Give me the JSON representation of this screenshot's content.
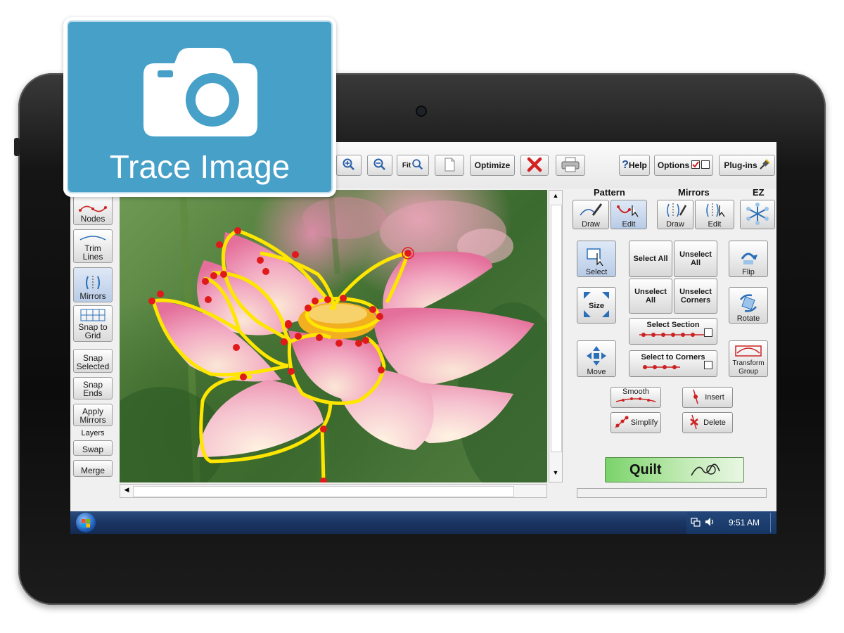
{
  "toolbar": {
    "zoom_fit_label": "Fit",
    "optimize_label": "Optimize",
    "help_label": "Help",
    "options_label": "Options",
    "plugins_label": "Plug-ins"
  },
  "left_tools": [
    {
      "label": "Nodes"
    },
    {
      "label": "Trim Lines"
    },
    {
      "label": "Mirrors"
    },
    {
      "label": "Snap to Grid"
    },
    {
      "label": "Snap Selected"
    },
    {
      "label": "Snap Ends"
    },
    {
      "label": "Apply Mirrors"
    },
    {
      "label": "Layers"
    },
    {
      "label": "Swap"
    },
    {
      "label": "Merge"
    }
  ],
  "panel": {
    "pattern_label": "Pattern",
    "mirrors_label": "Mirrors",
    "ez_label": "EZ",
    "draw_label": "Draw",
    "edit_label": "Edit",
    "select_label": "Select",
    "select_all_label": "Select All",
    "unselect_all_label": "Unselect All",
    "unselect_all_label2": "Unselect All",
    "unselect_corners_label": "Unselect Corners",
    "size_label": "Size",
    "select_section_label": "Select Section",
    "select_to_corners_label": "Select to Corners",
    "move_label": "Move",
    "flip_label": "Flip",
    "rotate_label": "Rotate",
    "transform_group_label": "Transform Group",
    "smooth_label": "Smooth",
    "insert_label": "Insert",
    "simplify_label": "Simplify",
    "delete_label": "Delete",
    "quilt_label": "Quilt"
  },
  "taskbar": {
    "clock": "9:51 AM"
  },
  "overlay": {
    "title": "Trace Image"
  },
  "colors": {
    "overlay_blue": "#46a0c8",
    "trace_yellow": "#ffe600",
    "node_red": "#e01a1a",
    "quilt_green": "#7ad36a"
  }
}
